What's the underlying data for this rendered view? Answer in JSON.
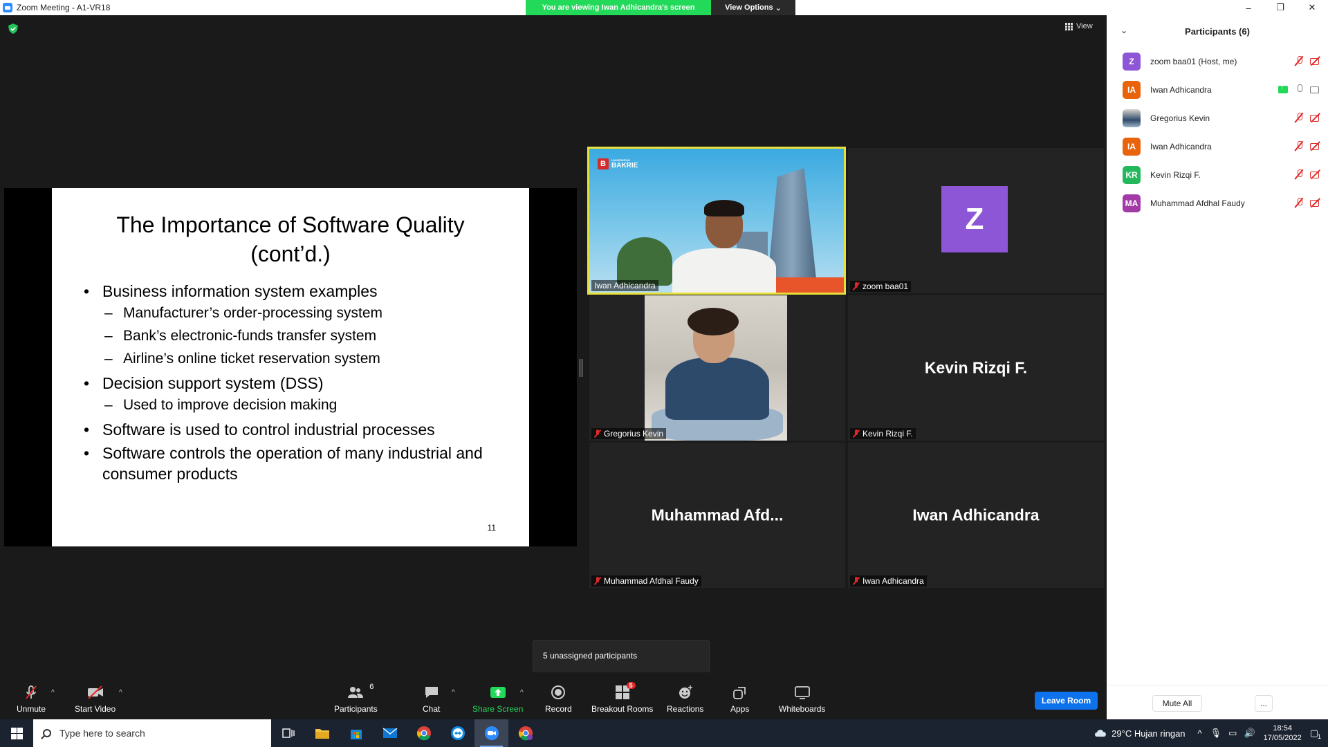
{
  "window": {
    "title": "Zoom Meeting - A1-VR18",
    "controls": {
      "minimize": "–",
      "restore": "❐",
      "close": "✕"
    }
  },
  "banner": {
    "viewing_text": "You are viewing Iwan Adhicandra's screen",
    "view_options": "View Options"
  },
  "meeting": {
    "view_label": "View",
    "slide": {
      "title_line1": "The Importance of Software Quality",
      "title_line2": "(cont’d.)",
      "bullets": [
        "Business information system examples",
        "Manufacturer’s order-processing system",
        "Bank’s electronic-funds transfer system",
        "Airline’s online ticket reservation system",
        "Decision support system (DSS)",
        "Used to improve decision making",
        "Software is used to control industrial processes",
        "Software controls the operation of many industrial and consumer products"
      ],
      "page_number": "11"
    },
    "tiles": [
      {
        "name": "Iwan Adhicandra",
        "big": "",
        "logo_text": "BAKRIE",
        "logo_small": "UNIVERSITAS"
      },
      {
        "name": "zoom baa01",
        "avatar_letter": "Z"
      },
      {
        "name": "Gregorius Kevin"
      },
      {
        "name": "Kevin Rizqi F.",
        "big": "Kevin Rizqi F."
      },
      {
        "name": "Muhammad Afdhal Faudy",
        "big": "Muhammad  Afd..."
      },
      {
        "name": "Iwan Adhicandra",
        "big": "Iwan Adhicandra"
      }
    ],
    "tooltip": "5 unassigned participants"
  },
  "toolbar": {
    "unmute": "Unmute",
    "start_video": "Start Video",
    "participants": "Participants",
    "participants_count": "6",
    "chat": "Chat",
    "share_screen": "Share Screen",
    "record": "Record",
    "breakout_rooms": "Breakout Rooms",
    "breakout_badge": "5",
    "reactions": "Reactions",
    "apps": "Apps",
    "whiteboards": "Whiteboards",
    "leave_room": "Leave Room"
  },
  "participants_panel": {
    "title": "Participants (6)",
    "items": [
      {
        "initials": "Z",
        "name": "zoom baa01 (Host, me)",
        "color": "#8d56d6"
      },
      {
        "initials": "IA",
        "name": "Iwan Adhicandra",
        "color": "#e8630a"
      },
      {
        "initials": "",
        "name": "Gregorius Kevin",
        "color": "#4a6a8a"
      },
      {
        "initials": "IA",
        "name": "Iwan Adhicandra",
        "color": "#e8630a"
      },
      {
        "initials": "KR",
        "name": "Kevin Rizqi F.",
        "color": "#23b85c"
      },
      {
        "initials": "MA",
        "name": "Muhammad Afdhal Faudy",
        "color": "#a23aa8"
      }
    ],
    "mute_all": "Mute All",
    "more": "..."
  },
  "taskbar": {
    "search_placeholder": "Type here to search",
    "weather": "29°C  Hujan ringan",
    "time": "18:54",
    "date": "17/05/2022",
    "notifications": "1"
  }
}
